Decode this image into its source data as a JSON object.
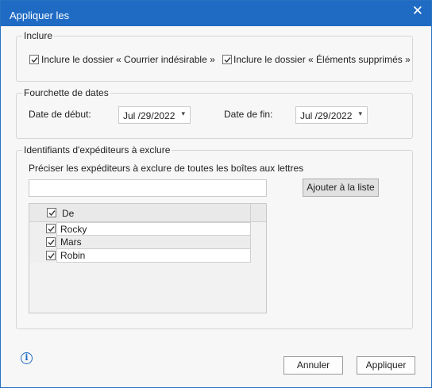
{
  "dialog": {
    "title": "Appliquer les",
    "close_glyph": "✕"
  },
  "include_group": {
    "label": "Inclure",
    "junk_checkbox": {
      "label": "Inclure le dossier « Courrier indésirable »",
      "checked": true
    },
    "deleted_checkbox": {
      "label": "Inclure le dossier « Éléments supprimés »",
      "checked": true
    }
  },
  "date_group": {
    "label": "Fourchette de dates",
    "start": {
      "label": "Date de début:",
      "value": "Jul /29/2022"
    },
    "end": {
      "label": "Date de fin:",
      "value": "Jul /29/2022"
    },
    "chevron_icon": "chevron-down-icon"
  },
  "sender_group": {
    "label": "Identifiants d'expéditeurs à exclure",
    "instruction": "Préciser les expéditeurs à exclure de toutes les boîtes aux lettres",
    "sender_input_value": "",
    "add_button": "Ajouter à la liste",
    "table": {
      "header": "De",
      "header_checked": true,
      "rows": [
        {
          "name": "Rocky",
          "checked": true
        },
        {
          "name": "Mars",
          "checked": true
        },
        {
          "name": "Robin",
          "checked": true
        }
      ]
    }
  },
  "footer": {
    "info_icon": "info-icon",
    "info_glyph": "i",
    "cancel_button": "Annuler",
    "apply_button": "Appliquer"
  },
  "colors": {
    "titlebar": "#1f6bc4",
    "accent": "#1f6bc4",
    "background": "#f7f7f7"
  }
}
